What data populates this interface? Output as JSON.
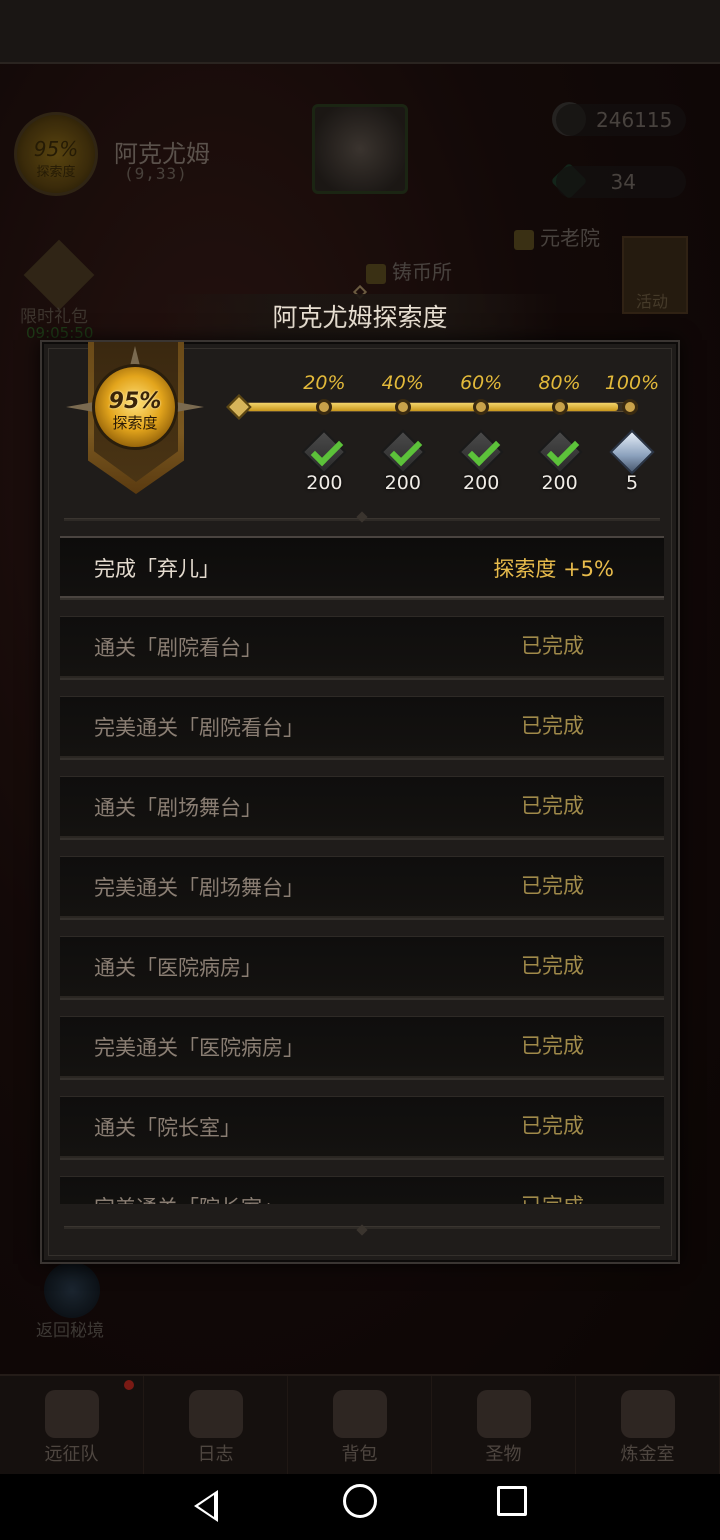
{
  "map": {
    "name": "阿克尤姆",
    "coords": "(9,33)",
    "explore_pct": "95%",
    "explore_label": "探索度"
  },
  "resources": {
    "stone": "246115",
    "gem": "34"
  },
  "tags": {
    "elder_house": "元老院",
    "mint": "铸币所"
  },
  "left_hud": {
    "gift_label": "限时礼包",
    "timer": "09:05:50"
  },
  "activity_label": "活动",
  "return_label": "返回秘境",
  "bottom_nav": [
    "远征队",
    "日志",
    "背包",
    "圣物",
    "炼金室"
  ],
  "modal": {
    "title": "阿克尤姆探索度",
    "badge_pct": "95%",
    "badge_label": "探索度",
    "progress_fraction": 0.95,
    "milestones": [
      {
        "pct": "20%",
        "reward": "200",
        "claimed": true,
        "icon": "ore-icon"
      },
      {
        "pct": "40%",
        "reward": "200",
        "claimed": true,
        "icon": "ore-icon"
      },
      {
        "pct": "60%",
        "reward": "200",
        "claimed": true,
        "icon": "ore-icon"
      },
      {
        "pct": "80%",
        "reward": "200",
        "claimed": true,
        "icon": "ore-icon"
      },
      {
        "pct": "100%",
        "reward": "5",
        "claimed": false,
        "icon": "crystal-icon"
      }
    ],
    "current_task": {
      "name": "完成「弃儿」",
      "status": "探索度 +5%"
    },
    "tasks": [
      {
        "name": "通关「剧院看台」",
        "status": "已完成"
      },
      {
        "name": "完美通关「剧院看台」",
        "status": "已完成"
      },
      {
        "name": "通关「剧场舞台」",
        "status": "已完成"
      },
      {
        "name": "完美通关「剧场舞台」",
        "status": "已完成"
      },
      {
        "name": "通关「医院病房」",
        "status": "已完成"
      },
      {
        "name": "完美通关「医院病房」",
        "status": "已完成"
      },
      {
        "name": "通关「院长室」",
        "status": "已完成"
      },
      {
        "name": "完美通关「院长室」",
        "status": "已完成"
      }
    ]
  },
  "colors": {
    "accent_gold": "#e2b93a",
    "check_green": "#5cc23a",
    "panel_bg": "#1f1c1a"
  }
}
